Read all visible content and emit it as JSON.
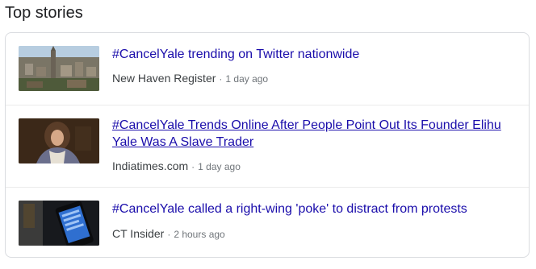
{
  "section": {
    "title": "Top stories"
  },
  "stories": [
    {
      "headline": "#CancelYale trending on Twitter nationwide",
      "source": "New Haven Register",
      "separator": "·",
      "time": "1 day ago",
      "thumbnail_icon": "city-aerial-photo"
    },
    {
      "headline": "#CancelYale Trends Online After People Point Out Its Founder Elihu Yale Was A Slave Trader",
      "source": "Indiatimes.com",
      "separator": "·",
      "time": "1 day ago",
      "thumbnail_icon": "historical-portrait-photo"
    },
    {
      "headline": "#CancelYale called a right-wing 'poke' to distract from protests",
      "source": "CT Insider",
      "separator": "·",
      "time": "2 hours ago",
      "thumbnail_icon": "smartphone-photo"
    }
  ],
  "colors": {
    "link": "#1a0dab",
    "text": "#202124",
    "meta": "#70757a",
    "border": "#dadce0"
  }
}
